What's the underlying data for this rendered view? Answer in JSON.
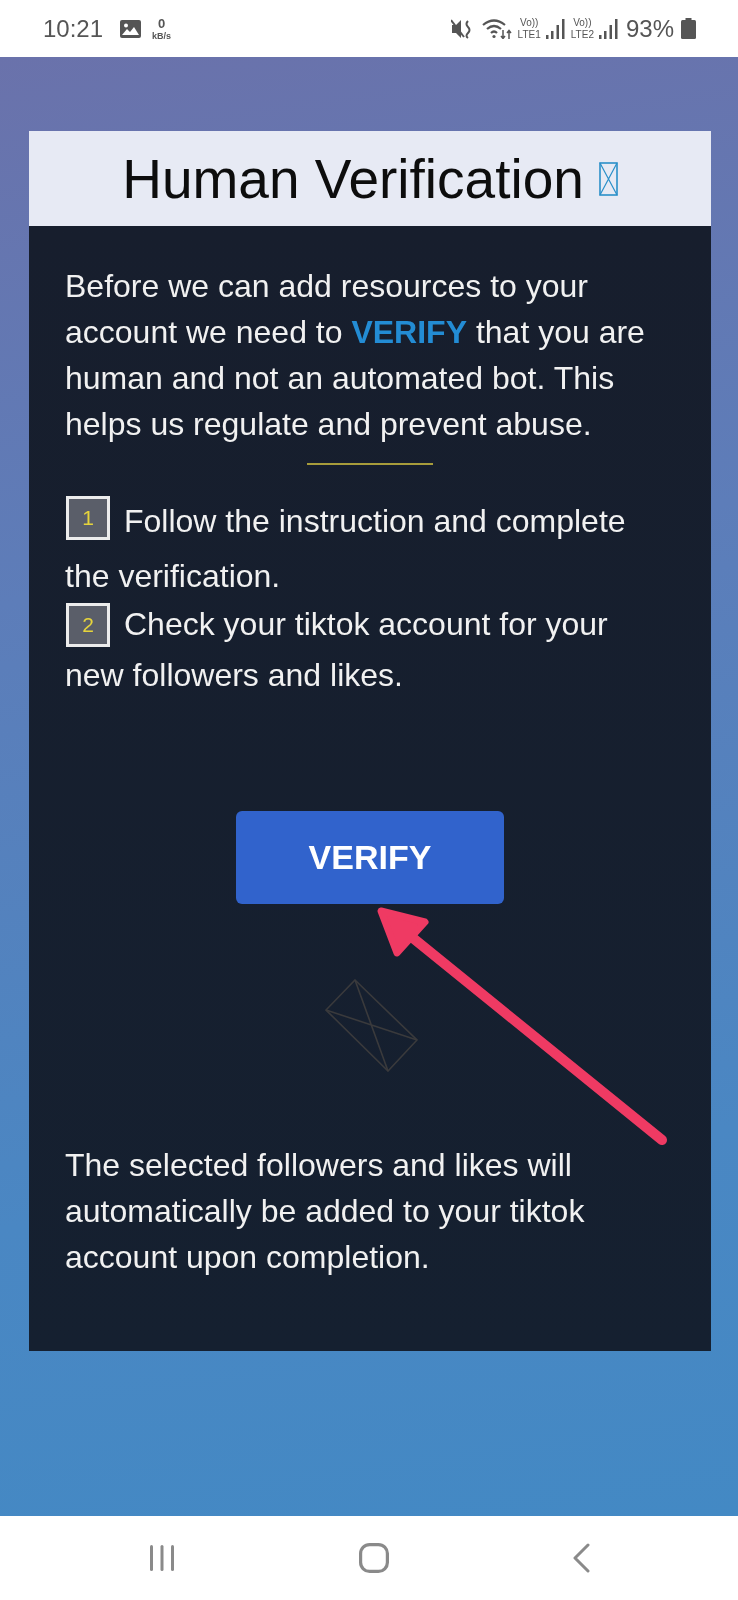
{
  "status_bar": {
    "time": "10:21",
    "speed": {
      "value": "0",
      "unit": "kB/s"
    },
    "sims": [
      {
        "volte": "Vo))",
        "network": "LTE1"
      },
      {
        "volte": "Vo))",
        "network": "LTE2"
      }
    ],
    "battery": "93%"
  },
  "card": {
    "title": "Human Verification",
    "intro": "Before we can add resources to your account we need to **VERIFY** that you are human and not an automated bot. This helps us regulate and prevent abuse.",
    "steps": [
      {
        "number": "1",
        "text": "Follow the instruction and complete the verification."
      },
      {
        "number": "2",
        "text": "Check your tiktok account for your new followers and likes."
      }
    ],
    "button": {
      "label": "VERIFY"
    },
    "note": "The selected followers and likes will automatically be added to your tiktok account upon completion."
  }
}
